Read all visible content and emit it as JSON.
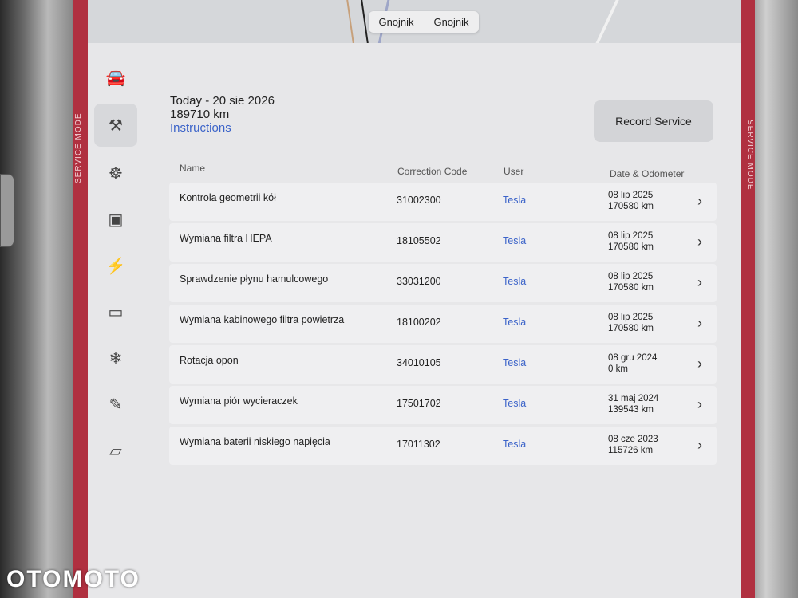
{
  "map": {
    "label_a": "Gnojnik",
    "label_b": "Gnojnik"
  },
  "service_mode_label": "SERVICE MODE",
  "sidebar": {
    "items": [
      {
        "icon": "car-icon",
        "glyph": "🚘"
      },
      {
        "icon": "tools-icon",
        "glyph": "⚒"
      },
      {
        "icon": "steering-wheel-icon",
        "glyph": "☸"
      },
      {
        "icon": "chip-icon",
        "glyph": "▣"
      },
      {
        "icon": "lightning-icon",
        "glyph": "⚡"
      },
      {
        "icon": "battery-icon",
        "glyph": "▭"
      },
      {
        "icon": "snowflake-icon",
        "glyph": "❄"
      },
      {
        "icon": "probe-icon",
        "glyph": "✎"
      },
      {
        "icon": "door-icon",
        "glyph": "▱"
      }
    ]
  },
  "header": {
    "date": "Today - 20 sie 2026",
    "odometer": "189710 km",
    "instructions_link": "Instructions"
  },
  "record_service_label": "Record Service",
  "columns": {
    "name": "Name",
    "code": "Correction Code",
    "user": "User",
    "date": "Date & Odometer"
  },
  "rows": [
    {
      "name": "Kontrola geometrii kół",
      "code": "31002300",
      "user": "Tesla",
      "date": "08 lip 2025",
      "odometer": "170580 km"
    },
    {
      "name": "Wymiana filtra HEPA",
      "code": "18105502",
      "user": "Tesla",
      "date": "08 lip 2025",
      "odometer": "170580 km"
    },
    {
      "name": "Sprawdzenie płynu hamulcowego",
      "code": "33031200",
      "user": "Tesla",
      "date": "08 lip 2025",
      "odometer": "170580 km"
    },
    {
      "name": "Wymiana kabinowego filtra powietrza",
      "code": "18100202",
      "user": "Tesla",
      "date": "08 lip 2025",
      "odometer": "170580 km"
    },
    {
      "name": "Rotacja opon",
      "code": "34010105",
      "user": "Tesla",
      "date": "08 gru 2024",
      "odometer": "0 km"
    },
    {
      "name": "Wymiana piór wycieraczek",
      "code": "17501702",
      "user": "Tesla",
      "date": "31 maj 2024",
      "odometer": "139543 km"
    },
    {
      "name": "Wymiana baterii niskiego napięcia",
      "code": "17011302",
      "user": "Tesla",
      "date": "08 cze 2023",
      "odometer": "115726 km"
    }
  ],
  "chevron": "›",
  "watermark": "OTOMOTO"
}
